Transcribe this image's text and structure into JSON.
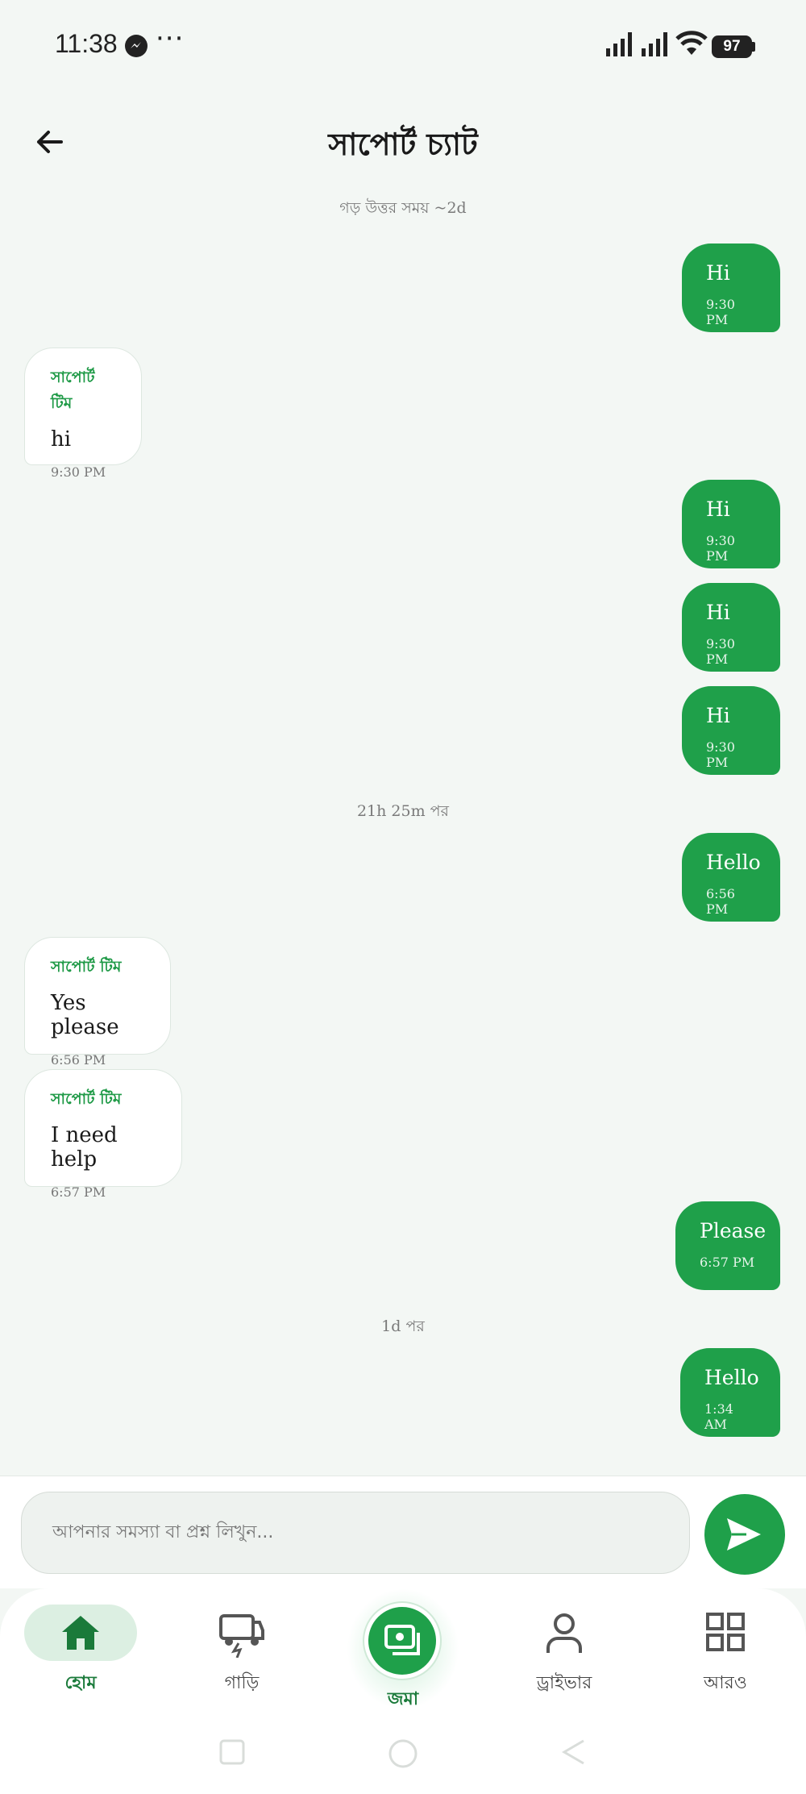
{
  "status_bar": {
    "time": "11:38",
    "battery": "97"
  },
  "header": {
    "title": "সাপোর্ট চ্যাট"
  },
  "notes": {
    "avg_reply": "গড় উত্তর সময় ~2d",
    "gap1": "21h 25m পর",
    "gap2": "1d পর"
  },
  "messages": [
    {
      "dir": "out",
      "text": "Hi",
      "time": "9:30 PM"
    },
    {
      "dir": "in",
      "sender": "সাপোর্ট টিম",
      "text": "hi",
      "time": "9:30 PM"
    },
    {
      "dir": "out",
      "text": "Hi",
      "time": "9:30 PM"
    },
    {
      "dir": "out",
      "text": "Hi",
      "time": "9:30 PM"
    },
    {
      "dir": "out",
      "text": "Hi",
      "time": "9:30 PM"
    },
    {
      "dir": "out",
      "text": "Hello",
      "time": "6:56 PM"
    },
    {
      "dir": "in",
      "sender": "সাপোর্ট টিম",
      "text": "Yes please",
      "time": "6:56 PM"
    },
    {
      "dir": "in",
      "sender": "সাপোর্ট টিম",
      "text": "I need help",
      "time": "6:57 PM"
    },
    {
      "dir": "out",
      "text": "Please",
      "time": "6:57 PM"
    },
    {
      "dir": "out",
      "text": "Hello",
      "time": "1:34 AM"
    }
  ],
  "composer": {
    "placeholder": "আপনার সমস্যা বা প্রশ্ন লিখুন..."
  },
  "nav": {
    "home": "হোম",
    "vehicles": "গাড়ি",
    "deposit": "জমা",
    "driver": "ড্রাইভার",
    "more": "আরও"
  },
  "colors": {
    "accent": "#1fa04a",
    "background": "#f3f7f4"
  }
}
